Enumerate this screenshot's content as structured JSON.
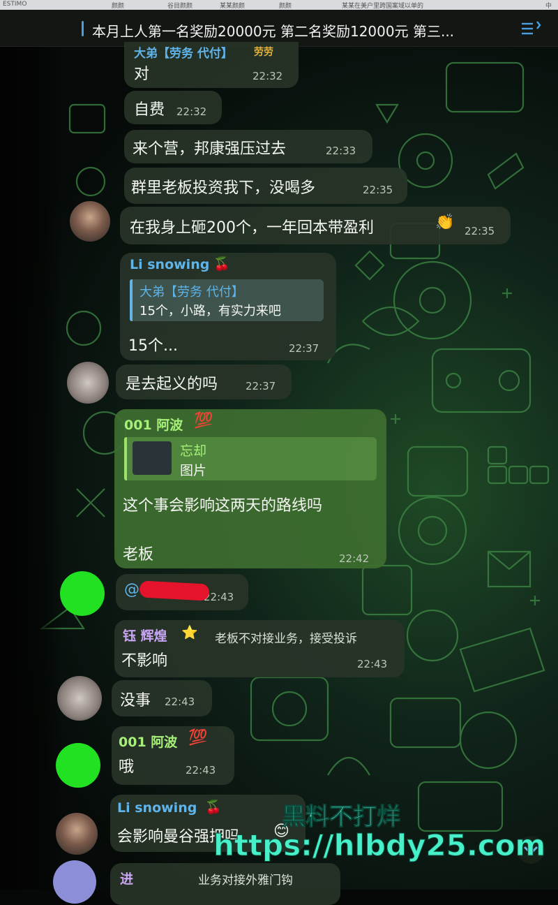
{
  "browser_tabs": [
    "ESTIMO",
    "颜颜",
    "谷目颜颜",
    "某某颜颜",
    "颜颜",
    "某某在美户里跨国案域以单的",
    "中"
  ],
  "pinned": {
    "text": "本月上人第一名奖励20000元 第二名奖励12000元 第三...",
    "icon": "pinned-list-icon"
  },
  "messages": [
    {
      "sender": "大弟【劳务 代付】",
      "badge": "劳劳",
      "text": "对",
      "time": "22:32"
    },
    {
      "text": "自费",
      "time": "22:32"
    },
    {
      "text": "来个营，邦康强压过去",
      "time": "22:33"
    },
    {
      "text": "群里老板投资我下，没喝多",
      "time": "22:35"
    },
    {
      "text": "在我身上砸200个，一年回本带盈利",
      "emoji": "👏",
      "time": "22:35"
    },
    {
      "sender": "Li snowing",
      "sender_emoji": "🍒",
      "reply_name": "大弟【劳务 代付】",
      "reply_text": "15个，小路，有实力来吧",
      "text": "15个...",
      "time": "22:37"
    },
    {
      "text": "是去起义的吗",
      "time": "22:37"
    },
    {
      "sender": "001 阿波",
      "sender_emoji": "💯",
      "reply_name": "忘却",
      "reply_text": "图片",
      "text": "这个事会影响这两天的路线吗",
      "text2": "老板",
      "time": "22:42"
    },
    {
      "text": "@",
      "time": "22:43"
    },
    {
      "sender": "钰 辉煌",
      "sender_emoji": "⭐",
      "title_tag": "老板不对接业务，接受投诉",
      "text": "不影响",
      "time": "22:43"
    },
    {
      "text": "没事",
      "time": "22:43"
    },
    {
      "sender": "001 阿波",
      "sender_emoji": "💯",
      "text": "哦",
      "time": "22:43"
    },
    {
      "sender": "Li snowing",
      "sender_emoji": "🍒",
      "text": "会影响曼谷强押吗",
      "emoji": "😊"
    },
    {
      "sender": "进",
      "title_tag": "业务对接外雅门钩"
    }
  ],
  "watermark": {
    "line1": "黑料不打烊",
    "line2": "https://hlbdy25.com"
  },
  "colors": {
    "sender_blue": "#5fb4ea",
    "sender_green": "#a6f07a",
    "sender_purple": "#c9a6f3",
    "wm": "#47f0c9"
  }
}
